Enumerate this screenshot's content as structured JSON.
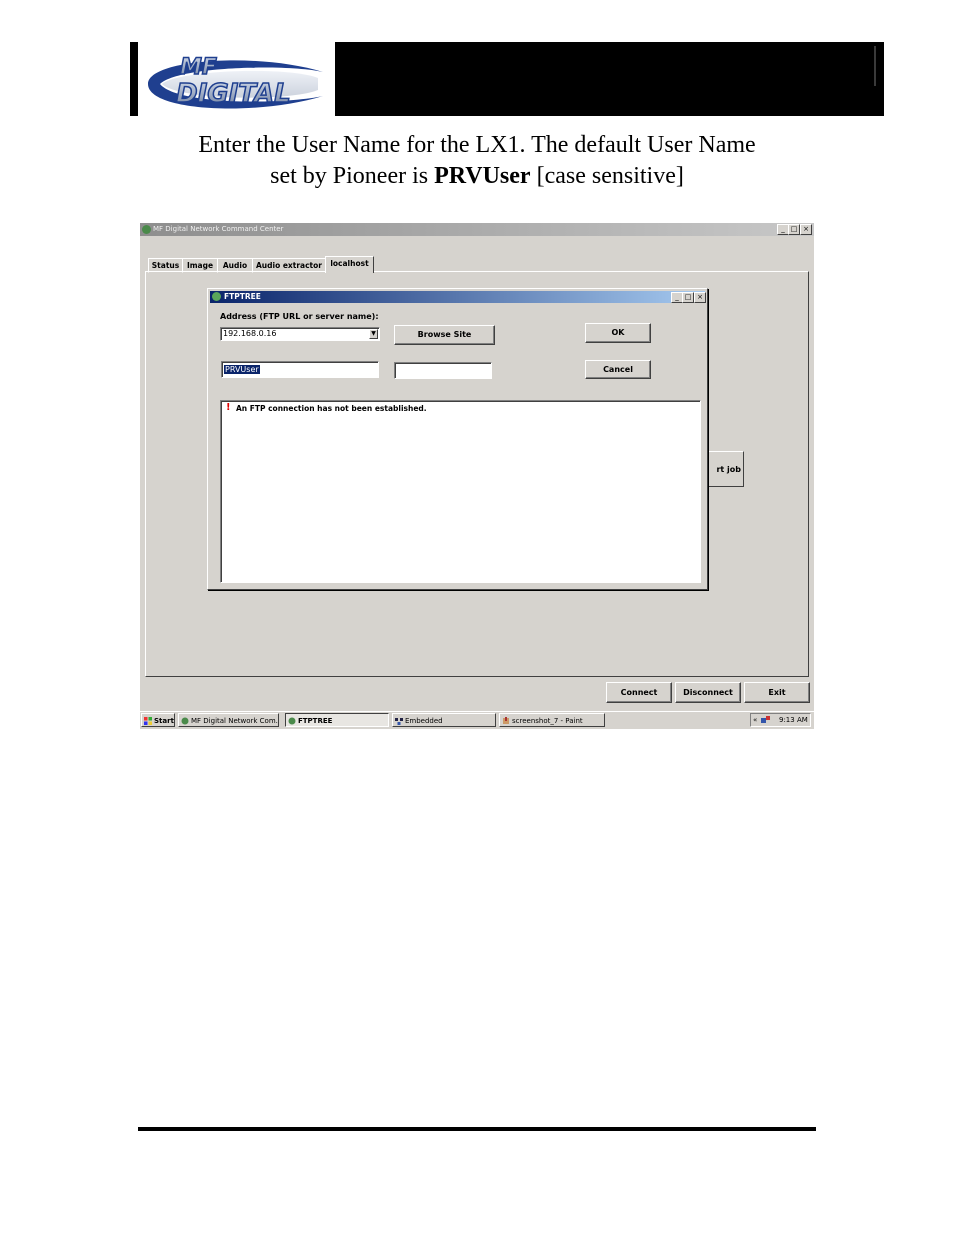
{
  "header": {
    "logo_top": "MF",
    "logo_bottom": "DIGITAL",
    "caption_line1": "Enter the User Name for the LX1.  The default User Name",
    "caption_line2_pre": "set by Pioneer is ",
    "caption_line2_bold": "PRVUser",
    "caption_line2_post": " [case sensitive]"
  },
  "app": {
    "title": "MF Digital Network Command Center",
    "win_min": "_",
    "win_max": "□",
    "win_close": "×",
    "tabs": [
      {
        "label": "Status"
      },
      {
        "label": "Image"
      },
      {
        "label": "Audio"
      },
      {
        "label": "Audio extractor"
      },
      {
        "label": "localhost"
      }
    ],
    "start_job_partial": "rt job",
    "connect_label": "Connect",
    "disconnect_label": "Disconnect",
    "exit_label": "Exit"
  },
  "dialog": {
    "title": "FTPTREE",
    "address_label": "Address (FTP URL or server name):",
    "address_value": "192.168.0.16",
    "browse_label": "Browse Site",
    "ok_label": "OK",
    "cancel_label": "Cancel",
    "username_value": "PRVUser",
    "password_value": "",
    "warning_glyph": "!",
    "message": "An FTP connection has not been established."
  },
  "taskbar": {
    "start_label": "Start",
    "items": [
      {
        "label": "MF Digital Network Com..."
      },
      {
        "label": "FTPTREE"
      },
      {
        "label": "Embedded"
      },
      {
        "label": "screenshot_7 - Paint"
      }
    ],
    "tray_arrows": "«",
    "clock": "9:13 AM"
  },
  "colors": {
    "window_face": "#d6d3ce",
    "dialog_title_start": "#0a246a",
    "dialog_title_end": "#a6caf0",
    "warning": "#e00000"
  }
}
